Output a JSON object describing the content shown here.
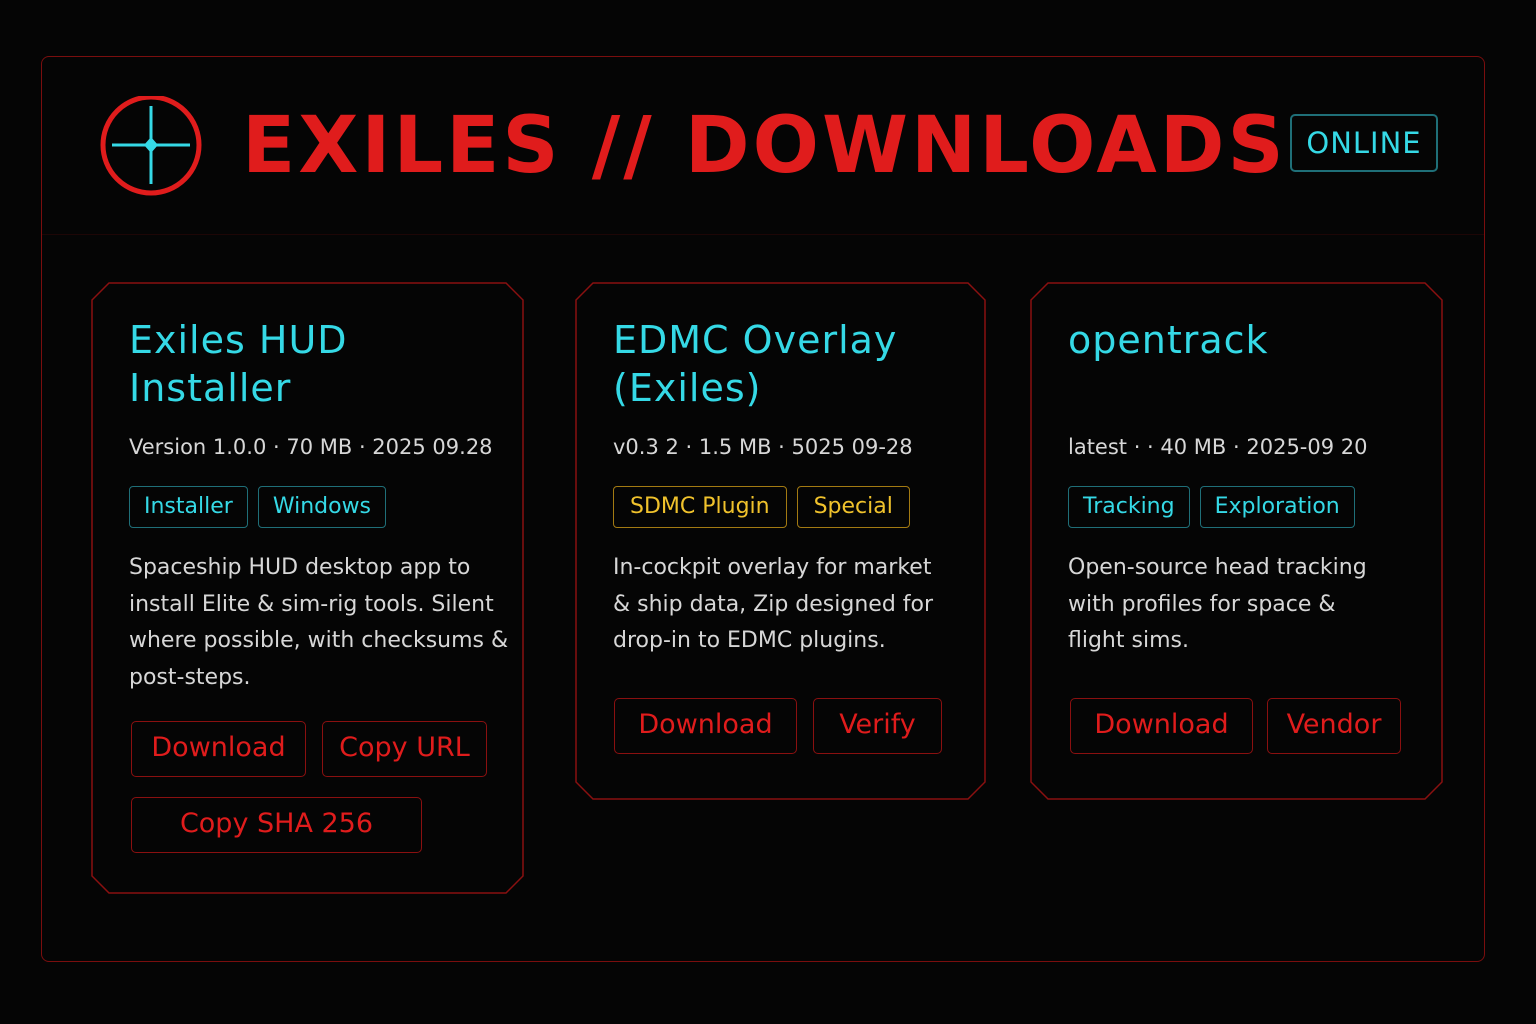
{
  "header": {
    "title": "EXILES // DOWNLOADS",
    "status": "ONLINE",
    "logo_icon": "crosshair-icon"
  },
  "colors": {
    "accent_red": "#e01c1c",
    "accent_cyan": "#35d9e6",
    "accent_gold": "#f0c22c",
    "background": "#050505"
  },
  "cards": [
    {
      "title_line1": "Exiles HUD",
      "title_line2": "Installer",
      "meta": "Version 1.0.0 · 70 MB · 2025 09.28",
      "tags": [
        "Installer",
        "Windows"
      ],
      "desc": "Spaceship HUD desktop app to install Elite & sim-rig tools. Silent where possible, with checksums & post-steps.",
      "buttons": [
        "Download",
        "Copy URL",
        "Copy SHA 256"
      ]
    },
    {
      "title_line1": "EDMC Overlay",
      "title_line2": "(Exiles)",
      "meta": "v0.3 2 · 1.5 MB · 5025 09-28",
      "tags": [
        "SDMC Plugin",
        "Special"
      ],
      "desc": "In-cockpit overlay for market & ship data, Zip designed for drop-in to EDMC plugins.",
      "buttons": [
        "Download",
        "Verify"
      ]
    },
    {
      "title_line1": "opentrack",
      "title_line2": "",
      "meta": "latest · · 40 MB  · 2025-09 20",
      "tags": [
        "Tracking",
        "Exploration"
      ],
      "desc": "Open-source head tracking with profiles for space & flight sims.",
      "buttons": [
        "Download",
        "Vendor"
      ]
    }
  ]
}
